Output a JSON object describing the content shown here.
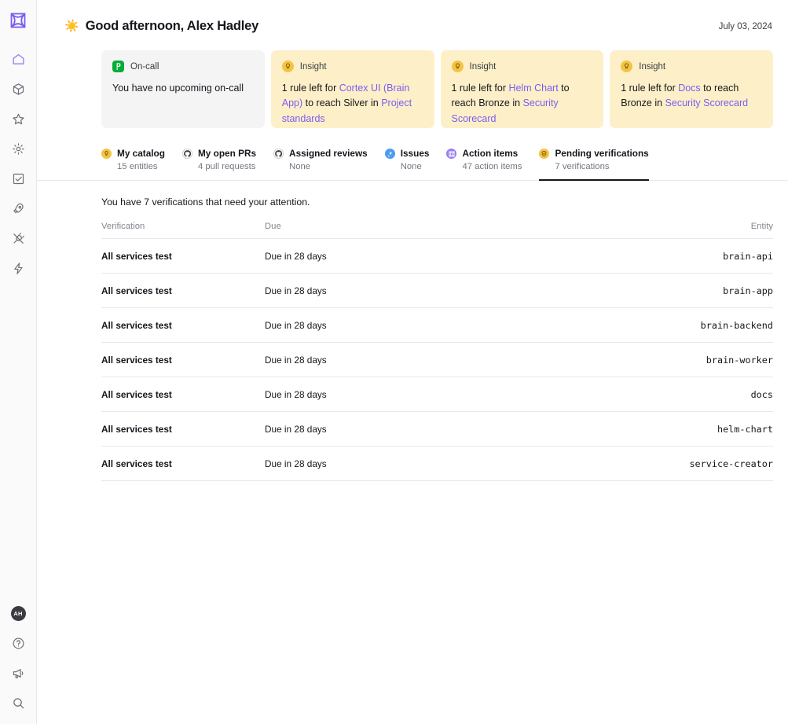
{
  "app": {
    "logo_icon": "cortex-logo-icon",
    "accent_purple": "#7b5cf0",
    "insight_bg": "#fdf0c8",
    "oncall_bg": "#f4f4f5"
  },
  "sidebar": {
    "top_items": [
      {
        "icon": "home-icon",
        "name": "sidebar-item-home",
        "active": true
      },
      {
        "icon": "cube-icon",
        "name": "sidebar-item-catalog",
        "active": false
      },
      {
        "icon": "star-icon",
        "name": "sidebar-item-scorecards",
        "active": false
      },
      {
        "icon": "gear-icon",
        "name": "sidebar-item-settings",
        "active": false
      },
      {
        "icon": "checkbox-icon",
        "name": "sidebar-item-initiatives",
        "active": false
      },
      {
        "icon": "rocket-icon",
        "name": "sidebar-item-eng-intelligence",
        "active": false
      },
      {
        "icon": "plug-icon",
        "name": "sidebar-item-integrations",
        "active": false
      },
      {
        "icon": "bolt-icon",
        "name": "sidebar-item-workflows",
        "active": false
      }
    ],
    "bottom_items": [
      {
        "icon": "avatar-icon",
        "name": "user-avatar",
        "label": "AH"
      },
      {
        "icon": "help-circle-icon",
        "name": "help-button",
        "label": ""
      },
      {
        "icon": "megaphone-icon",
        "name": "announcements-button",
        "label": ""
      },
      {
        "icon": "search-icon",
        "name": "search-button",
        "label": ""
      }
    ]
  },
  "header": {
    "emoji": "☀️",
    "greeting": "Good afternoon, Alex Hadley",
    "date": "July 03, 2024"
  },
  "cards": [
    {
      "type": "oncall",
      "badge_icon": "pagerduty-icon",
      "badge_letter": "P",
      "label": "On-call",
      "body": [
        {
          "t": "You have no upcoming on-call",
          "link": false
        }
      ]
    },
    {
      "type": "insight",
      "badge_icon": "lightbulb-icon",
      "badge_letter": "",
      "label": "Insight",
      "body": [
        {
          "t": "1 rule left for ",
          "link": false
        },
        {
          "t": "Cortex UI (Brain App)",
          "link": true
        },
        {
          "t": " to reach Silver in ",
          "link": false
        },
        {
          "t": "Project standards",
          "link": true
        }
      ]
    },
    {
      "type": "insight",
      "badge_icon": "lightbulb-icon",
      "badge_letter": "",
      "label": "Insight",
      "body": [
        {
          "t": "1 rule left for ",
          "link": false
        },
        {
          "t": "Helm Chart",
          "link": true
        },
        {
          "t": " to reach Bronze in ",
          "link": false
        },
        {
          "t": "Security Scorecard",
          "link": true
        }
      ]
    },
    {
      "type": "insight",
      "badge_icon": "lightbulb-icon",
      "badge_letter": "",
      "label": "Insight",
      "body": [
        {
          "t": "1 rule left for ",
          "link": false
        },
        {
          "t": "Docs",
          "link": true
        },
        {
          "t": " to reach Bronze in ",
          "link": false
        },
        {
          "t": "Security Scorecard",
          "link": true
        }
      ]
    }
  ],
  "tabs": [
    {
      "name": "tab-my-catalog",
      "icon": "lightbulb-icon",
      "icon_kind": "bulb",
      "title": "My catalog",
      "sub": "15 entities",
      "active": false
    },
    {
      "name": "tab-my-open-prs",
      "icon": "github-icon",
      "icon_kind": "gh",
      "title": "My open PRs",
      "sub": "4 pull requests",
      "active": false
    },
    {
      "name": "tab-assigned-reviews",
      "icon": "github-icon",
      "icon_kind": "gh",
      "title": "Assigned reviews",
      "sub": "None",
      "active": false
    },
    {
      "name": "tab-issues",
      "icon": "jira-icon",
      "icon_kind": "jira",
      "title": "Issues",
      "sub": "None",
      "active": false
    },
    {
      "name": "tab-action-items",
      "icon": "cortex-icon",
      "icon_kind": "cortex",
      "title": "Action items",
      "sub": "47 action items",
      "active": false
    },
    {
      "name": "tab-pending-verifications",
      "icon": "shield-icon",
      "icon_kind": "shield",
      "title": "Pending verifications",
      "sub": "7 verifications",
      "active": true
    }
  ],
  "content": {
    "attention_text": "You have 7 verifications that need your attention.",
    "table": {
      "columns": [
        "Verification",
        "Due",
        "Entity"
      ],
      "rows": [
        {
          "verification": "All services test",
          "due": "Due in 28 days",
          "entity": "brain-api"
        },
        {
          "verification": "All services test",
          "due": "Due in 28 days",
          "entity": "brain-app"
        },
        {
          "verification": "All services test",
          "due": "Due in 28 days",
          "entity": "brain-backend"
        },
        {
          "verification": "All services test",
          "due": "Due in 28 days",
          "entity": "brain-worker"
        },
        {
          "verification": "All services test",
          "due": "Due in 28 days",
          "entity": "docs"
        },
        {
          "verification": "All services test",
          "due": "Due in 28 days",
          "entity": "helm-chart"
        },
        {
          "verification": "All services test",
          "due": "Due in 28 days",
          "entity": "service-creator"
        }
      ]
    }
  }
}
